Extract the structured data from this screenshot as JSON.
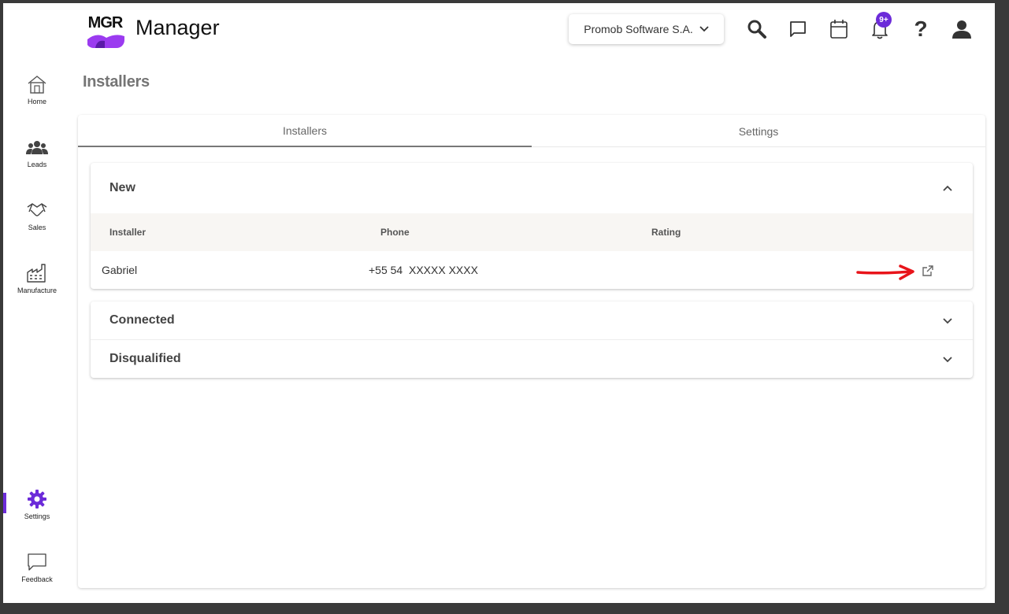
{
  "app": {
    "logo_text": "MGR",
    "title": "Manager",
    "company": "Promob Software S.A.",
    "notifications_badge": "9+",
    "accent_color": "#6c2bd9"
  },
  "header_icons": [
    "search-icon",
    "chat-icon",
    "calendar-icon",
    "bell-icon",
    "help-icon",
    "user-icon"
  ],
  "sidebar": {
    "items": [
      {
        "label": "Home",
        "icon": "home-icon"
      },
      {
        "label": "Leads",
        "icon": "people-icon"
      },
      {
        "label": "Sales",
        "icon": "handshake-icon"
      },
      {
        "label": "Manufacture",
        "icon": "factory-icon"
      },
      {
        "label": "Settings",
        "icon": "gear-icon",
        "active": true
      },
      {
        "label": "Feedback",
        "icon": "feedback-icon"
      }
    ]
  },
  "page": {
    "title": "Installers",
    "tabs": [
      {
        "label": "Installers",
        "active": true
      },
      {
        "label": "Settings",
        "active": false
      }
    ]
  },
  "sections": {
    "new": {
      "title": "New",
      "expanded": true,
      "columns": [
        "Installer",
        "Phone",
        "Rating"
      ],
      "rows": [
        {
          "installer": "Gabriel",
          "phone": "+55 54  XXXXX XXXX",
          "rating": ""
        }
      ]
    },
    "connected": {
      "title": "Connected",
      "expanded": false
    },
    "disqualified": {
      "title": "Disqualified",
      "expanded": false
    }
  }
}
